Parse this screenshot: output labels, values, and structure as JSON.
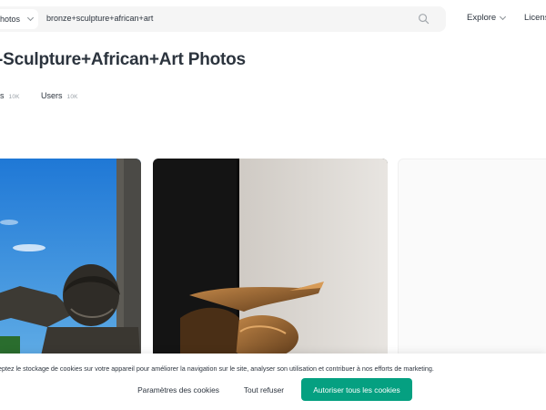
{
  "header": {
    "type_select_label": "hotos",
    "search_query": "bronze+sculpture+african+art",
    "nav_explore": "Explore",
    "nav_license": "License"
  },
  "page": {
    "title": "-Sculpture+African+Art Photos"
  },
  "tabs": [
    {
      "label": "os",
      "count": "10K"
    },
    {
      "label": "Users",
      "count": "10K"
    }
  ],
  "cookie_banner": {
    "text": "eptez le stockage de cookies sur votre appareil pour améliorer la navigation sur le site, analyser son utilisation et contribuer à nos efforts de marketing.",
    "settings_label": "Paramètres des cookies",
    "reject_label": "Tout refuser",
    "accept_label": "Autoriser tous les cookies"
  },
  "colors": {
    "accent": "#05a081",
    "text": "#2c343e",
    "muted": "#9aa1a8",
    "search_bg": "#f5f5f5"
  },
  "icons": {
    "search": "search-icon",
    "chevron": "chevron-down-icon"
  }
}
